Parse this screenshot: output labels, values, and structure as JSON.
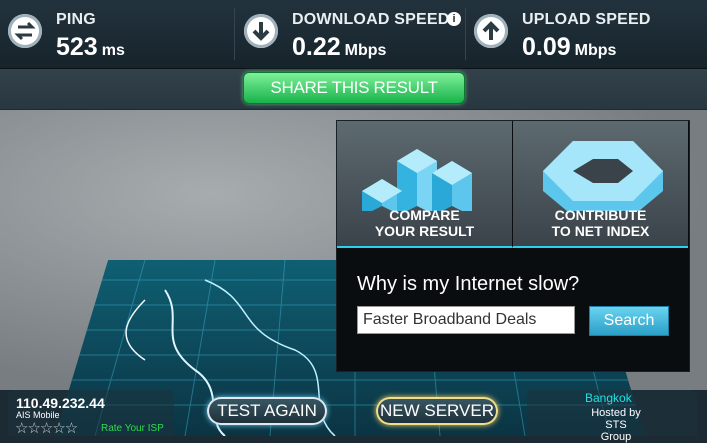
{
  "metrics": {
    "ping": {
      "label": "PING",
      "value": "523",
      "unit": "ms",
      "icon": "ping-arrows-icon"
    },
    "download": {
      "label": "DOWNLOAD SPEED",
      "value": "0.22",
      "unit": "Mbps",
      "icon": "download-arrow-icon",
      "info": "i"
    },
    "upload": {
      "label": "UPLOAD SPEED",
      "value": "0.09",
      "unit": "Mbps",
      "icon": "upload-arrow-icon"
    }
  },
  "share": {
    "label": "SHARE THIS RESULT"
  },
  "tiles": {
    "compare": {
      "line1": "COMPARE",
      "line2": "YOUR RESULT",
      "icon": "bar-chart-icon"
    },
    "contribute": {
      "line1": "CONTRIBUTE",
      "line2": "TO NET INDEX",
      "icon": "net-index-icon"
    }
  },
  "slow": {
    "question": "Why is my Internet slow?",
    "input_value": "Faster Broadband Deals",
    "button": "Search"
  },
  "client": {
    "ip": "110.49.232.44",
    "isp": "AIS Mobile",
    "stars": "☆☆☆☆☆",
    "rate_label": "Rate Your ISP"
  },
  "actions": {
    "test_again": "TEST AGAIN",
    "new_server": "NEW SERVER"
  },
  "server": {
    "city": "Bangkok",
    "hosted_by": "Hosted by",
    "host": "STS Group"
  },
  "colors": {
    "accent_green": "#18b34a",
    "accent_cyan": "#2ad0f0",
    "gold": "#f1de8a"
  }
}
